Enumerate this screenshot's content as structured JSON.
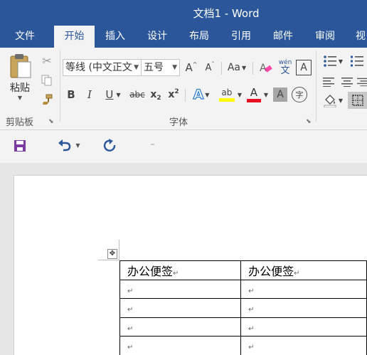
{
  "title_bar": {
    "title": "文档1 - Word"
  },
  "tabs": [
    {
      "label": "文件"
    },
    {
      "label": "开始"
    },
    {
      "label": "插入"
    },
    {
      "label": "设计"
    },
    {
      "label": "布局"
    },
    {
      "label": "引用"
    },
    {
      "label": "邮件"
    },
    {
      "label": "审阅"
    },
    {
      "label": "视"
    }
  ],
  "clipboard": {
    "paste_label": "粘贴",
    "group_label": "剪贴板"
  },
  "font": {
    "font_name": "等线 (中文正文",
    "font_size": "五号",
    "grow_label": "A",
    "shrink_label": "A",
    "case_label": "Aa",
    "phonetic_top": "wén",
    "phonetic_bottom": "文",
    "border_char_label": "A",
    "bold": "B",
    "italic": "I",
    "underline": "U",
    "strike": "abc",
    "subscript": "x",
    "subscript_small": "2",
    "superscript": "x",
    "superscript_small": "2",
    "effects_label": "A",
    "highlight_label": "ab",
    "font_color_label": "A",
    "shading_label": "A",
    "enclose_label": "字",
    "group_label": "字体",
    "highlight_color": "#ffff00",
    "font_color": "#e81123"
  },
  "document": {
    "table": {
      "header": [
        "办公便签",
        "办公便签"
      ],
      "rows": [
        [
          "↵",
          "↵"
        ],
        [
          "↵",
          "↵"
        ],
        [
          "↵",
          "↵"
        ],
        [
          "↵",
          "↵"
        ]
      ]
    },
    "para_mark": "↵"
  },
  "colors": {
    "accent": "#2b579a"
  }
}
